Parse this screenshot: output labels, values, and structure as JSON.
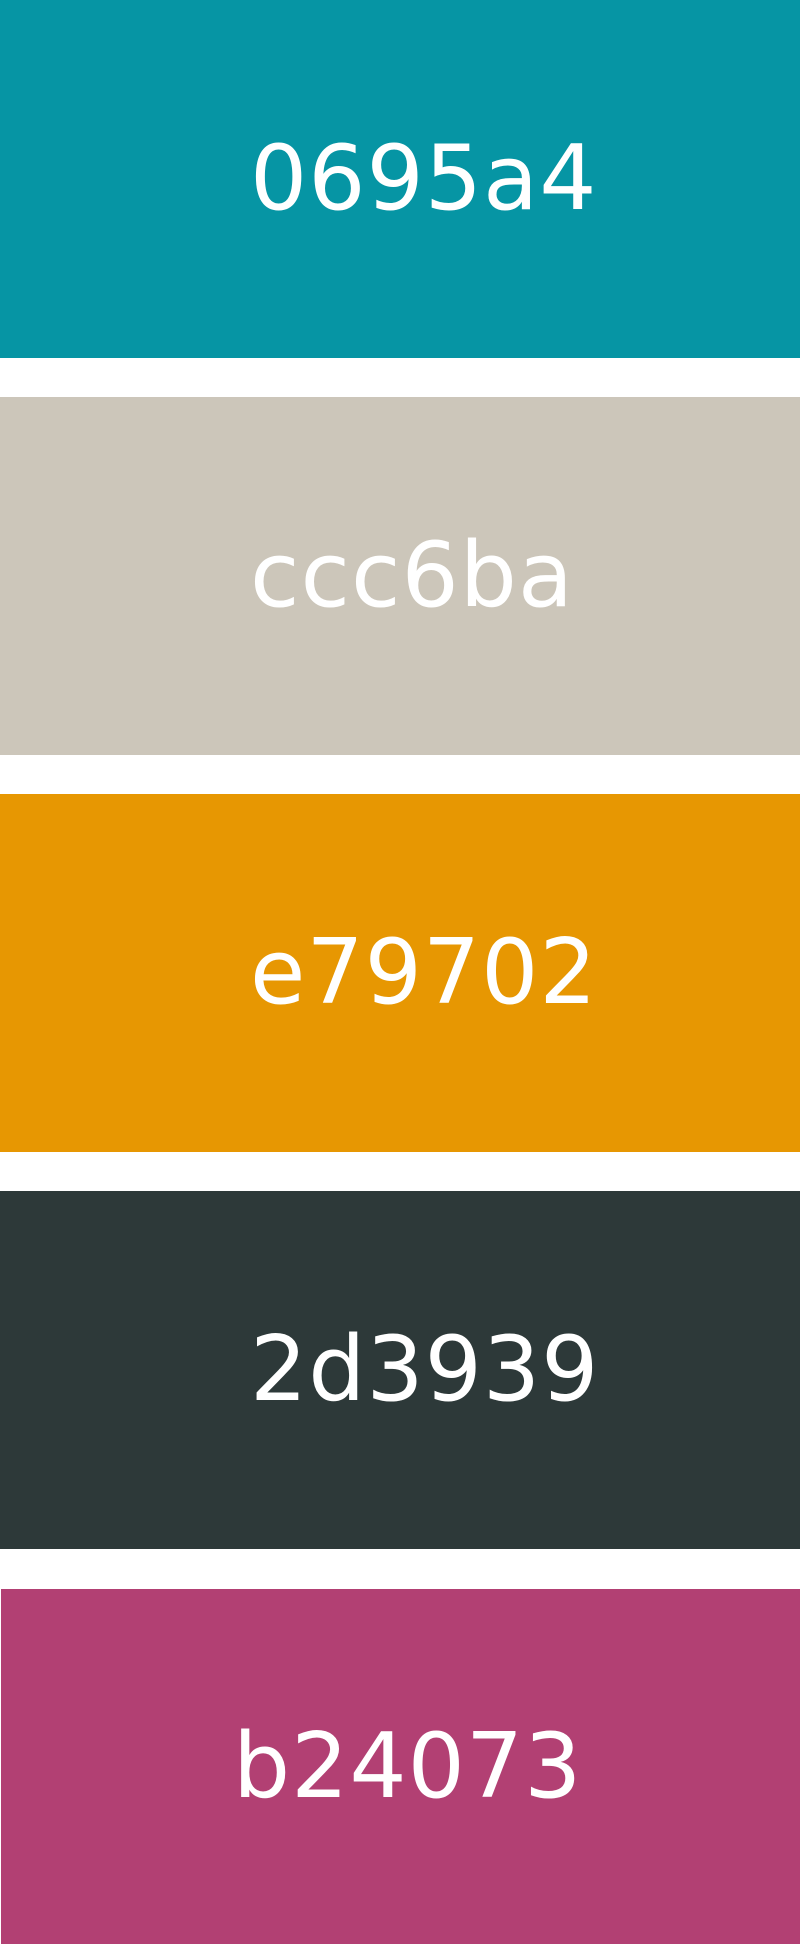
{
  "swatches": [
    {
      "label": "0695a4",
      "color": "#0695a4"
    },
    {
      "label": "ccc6ba",
      "color": "#ccc6ba"
    },
    {
      "label": "e79702",
      "color": "#e79702"
    },
    {
      "label": "2d3939",
      "color": "#2d3939"
    },
    {
      "label": "b24073",
      "color": "#b24073"
    }
  ]
}
